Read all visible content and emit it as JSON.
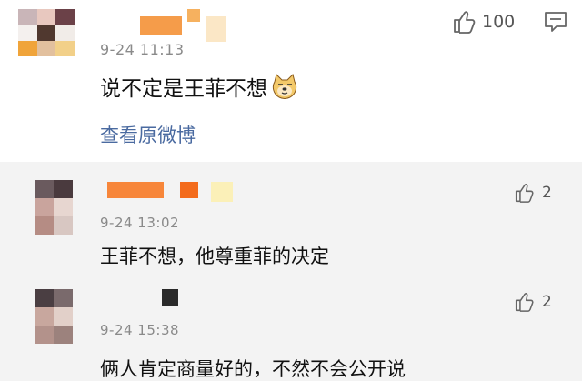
{
  "main_comment": {
    "timestamp": "9-24 11:13",
    "text": "说不定是王菲不想",
    "emoji": "doge-emoji",
    "likes": "100",
    "view_original": "查看原微博",
    "icons": [
      "thumbs-up-icon",
      "comment-icon"
    ]
  },
  "replies": [
    {
      "timestamp": "9-24 13:02",
      "text": "王菲不想，他尊重菲的决定",
      "likes": "2"
    },
    {
      "timestamp": "9-24 15:38",
      "text": "俩人肯定商量好的，不然不会公开说",
      "likes": "2"
    }
  ],
  "colors": {
    "username_orange": "#f7863a",
    "link_blue": "#4a6aa0",
    "reply_bg": "#f3f3f3",
    "timestamp_gray": "#8a8a8a"
  }
}
